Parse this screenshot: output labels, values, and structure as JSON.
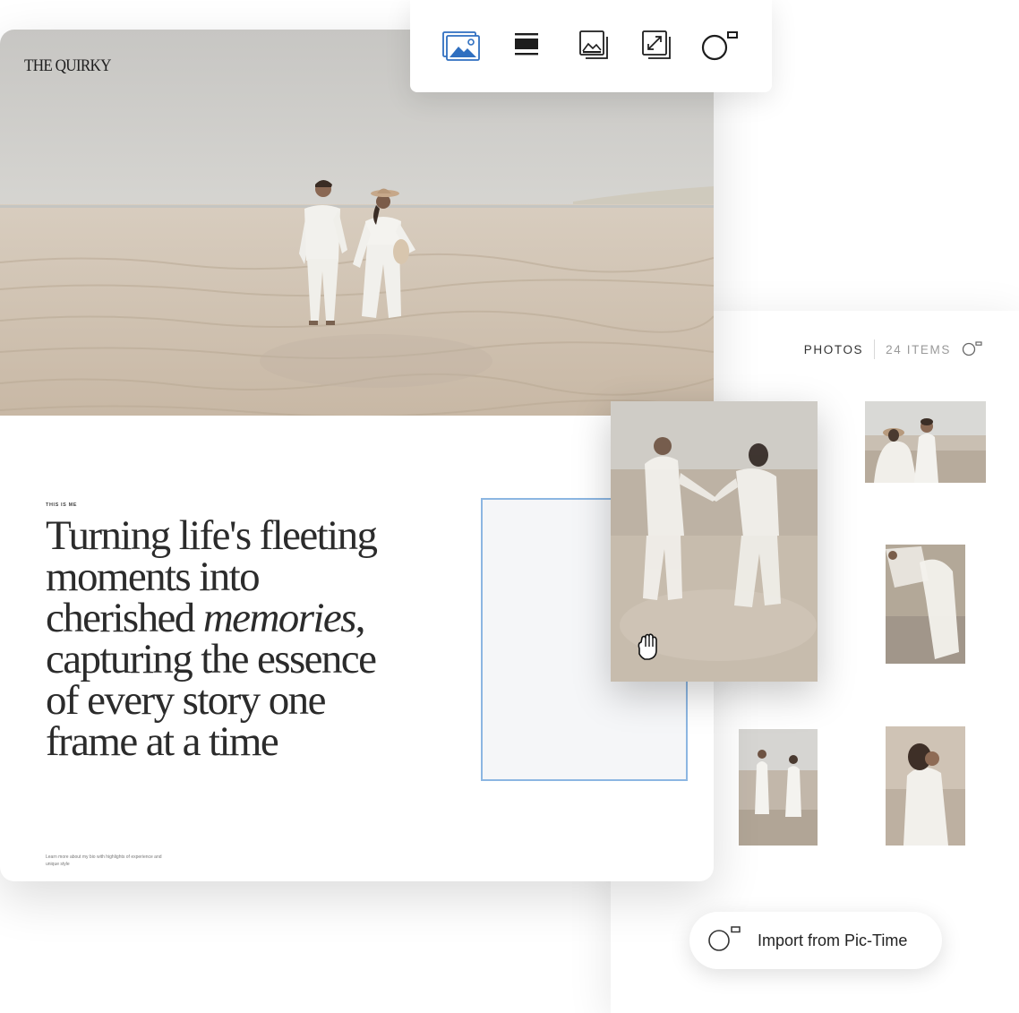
{
  "toolbar": {
    "tools": [
      {
        "name": "gallery-image-icon",
        "active": true
      },
      {
        "name": "banner-icon",
        "active": false
      },
      {
        "name": "image-stack-icon",
        "active": false
      },
      {
        "name": "resize-image-icon",
        "active": false
      },
      {
        "name": "pic-time-icon",
        "active": false
      }
    ],
    "accent": "#2f6fc0"
  },
  "site": {
    "brand": "THE QUIRKY",
    "eyebrow": "THIS IS ME",
    "headline": {
      "line1": "Turning life's fleeting",
      "line2": "moments into",
      "line3_pre": "cherished ",
      "line3_em": "memories",
      "line3_post": ",",
      "line4": "capturing the essence",
      "line5": "of every story one",
      "line6": "frame at a time"
    },
    "footnote": "Learn more about my bio with highlights of experience and unique style"
  },
  "photos_panel": {
    "label": "PHOTOS",
    "count": "24 ITEMS",
    "icon": "pic-time-icon"
  },
  "import_button": {
    "label": "Import from Pic-Time",
    "icon": "pic-time-icon"
  },
  "colors": {
    "placeholder_border": "#8cb6e2",
    "text_dark": "#2b2b2b",
    "muted": "#9a9a9a"
  }
}
